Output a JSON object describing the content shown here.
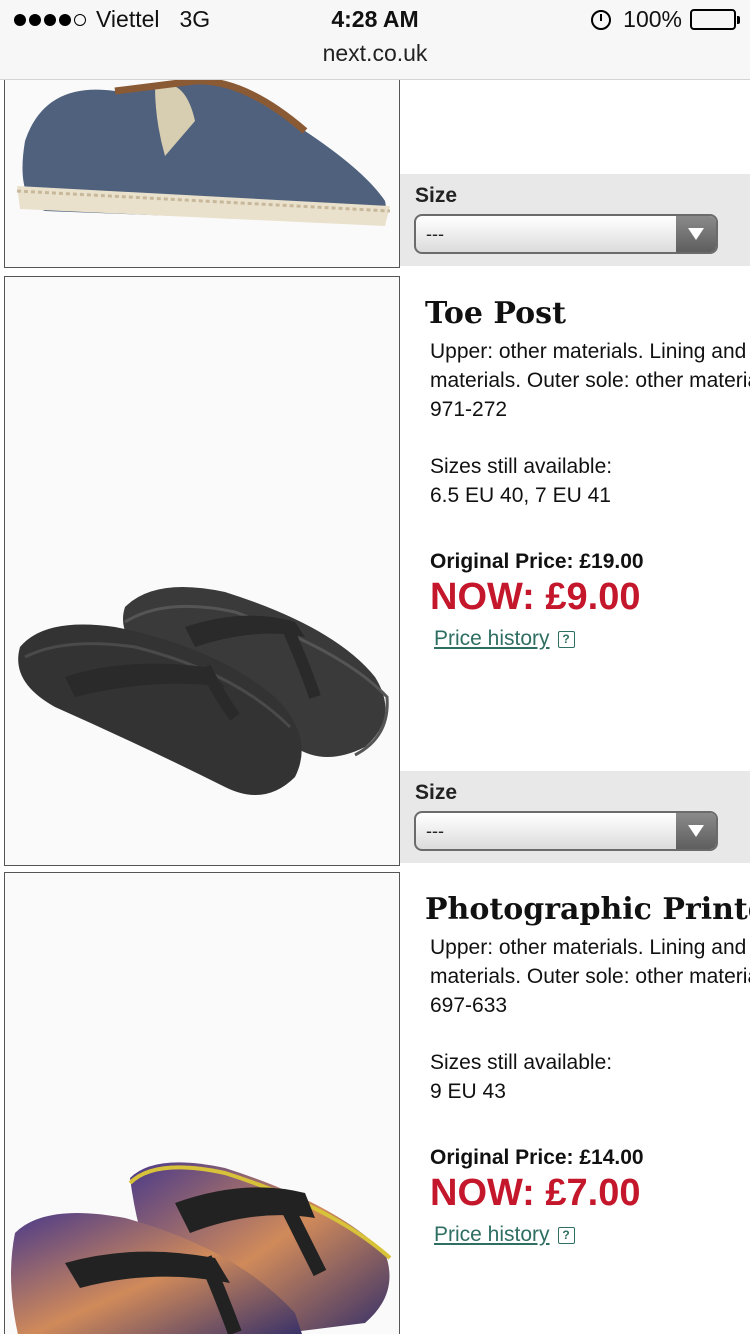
{
  "status_bar": {
    "carrier": "Viettel",
    "network": "3G",
    "time": "4:28 AM",
    "battery": "100%"
  },
  "browser": {
    "url": "next.co.uk"
  },
  "size_selector": {
    "label": "Size",
    "value": "---"
  },
  "products": [
    {
      "title": "Toe Post",
      "desc_line1": "Upper: other materials. Lining and",
      "desc_line2": "materials. Outer sole: other materials.",
      "code": "971-272",
      "sizes_label": "Sizes still available:",
      "sizes": "6.5 EU 40, 7 EU 41",
      "original_price": "Original Price: £19.00",
      "now_price": "NOW: £9.00",
      "history": "Price history",
      "image": "black-flip-flops-icon"
    },
    {
      "title": "Photographic Printed",
      "desc_line1": "Upper: other materials. Lining and",
      "desc_line2": "materials. Outer sole: other materials.",
      "code": "697-633",
      "sizes_label": "Sizes still available:",
      "sizes": "9 EU 43",
      "original_price": "Original Price: £14.00",
      "now_price": "NOW: £7.00",
      "history": "Price history",
      "image": "printed-flip-flops-icon"
    }
  ],
  "top_product": {
    "image": "denim-slip-on-shoe-icon"
  }
}
